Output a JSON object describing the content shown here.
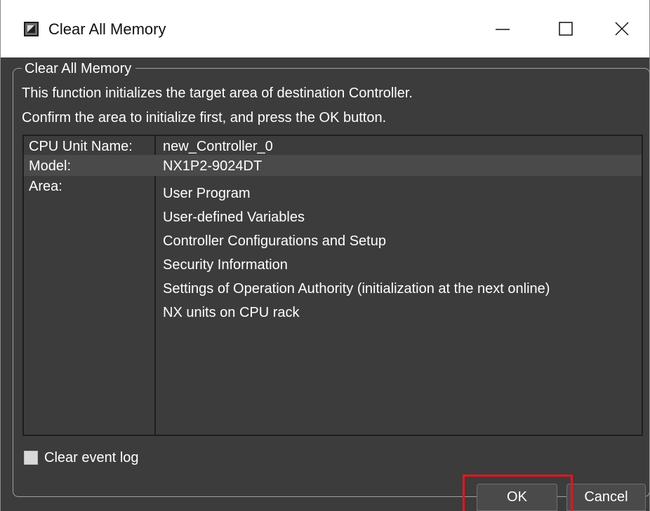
{
  "window": {
    "title": "Clear All Memory",
    "icons": {
      "app": "app-icon",
      "minimize": "minimize-icon",
      "maximize": "maximize-icon",
      "close": "close-icon"
    }
  },
  "group": {
    "legend": "Clear All Memory",
    "description_line1": "This function initializes the target area of destination Controller.",
    "description_line2": "Confirm the area to initialize first, and press the OK button."
  },
  "info": {
    "cpu_unit_name_label": "CPU Unit Name:",
    "cpu_unit_name_value": "new_Controller_0",
    "model_label": "Model:",
    "model_value": "NX1P2-9024DT",
    "area_label": "Area:",
    "area_items": [
      "User Program",
      "User-defined Variables",
      "Controller Configurations and Setup",
      "Security Information",
      "Settings of Operation Authority (initialization at the next online)",
      "NX units on CPU rack"
    ]
  },
  "options": {
    "clear_event_log_label": "Clear event log",
    "clear_event_log_checked": false
  },
  "buttons": {
    "ok_label": "OK",
    "cancel_label": "Cancel"
  },
  "colors": {
    "dialog_background": "#3c3c3c",
    "titlebar_background": "#ffffff",
    "highlight": "#e8141d"
  }
}
